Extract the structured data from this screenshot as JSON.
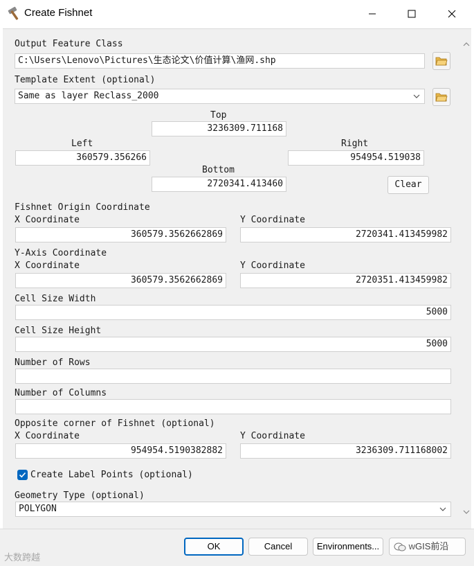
{
  "window": {
    "title": "Create Fishnet",
    "app_icon": "hammer-icon",
    "controls": [
      "minimize-icon",
      "maximize-icon",
      "close-icon"
    ]
  },
  "output_feature_class": {
    "label": "Output Feature Class",
    "value": "C:\\Users\\Lenovo\\Pictures\\生态论文\\价值计算\\渔网.shp"
  },
  "template_extent": {
    "label": "Template Extent (optional)",
    "value": "Same as layer Reclass_2000",
    "top_label": "Top",
    "top": "3236309.711168",
    "left_label": "Left",
    "left": "360579.356266",
    "right_label": "Right",
    "right": "954954.519038",
    "bottom_label": "Bottom",
    "bottom": "2720341.413460",
    "clear_label": "Clear"
  },
  "fishnet_origin": {
    "label": "Fishnet Origin Coordinate",
    "x_label": "X Coordinate",
    "x": "360579.3562662869",
    "y_label": "Y Coordinate",
    "y": "2720341.413459982"
  },
  "y_axis": {
    "label": "Y-Axis Coordinate",
    "x_label": "X Coordinate",
    "x": "360579.3562662869",
    "y_label": "Y Coordinate",
    "y": "2720351.413459982"
  },
  "cell_size_width": {
    "label": "Cell Size Width",
    "value": "5000"
  },
  "cell_size_height": {
    "label": "Cell Size Height",
    "value": "5000"
  },
  "number_of_rows": {
    "label": "Number of Rows",
    "value": ""
  },
  "number_of_columns": {
    "label": "Number of Columns",
    "value": ""
  },
  "opposite_corner": {
    "label": "Opposite corner of Fishnet (optional)",
    "x_label": "X Coordinate",
    "x": "954954.5190382882",
    "y_label": "Y Coordinate",
    "y": "3236309.711168002"
  },
  "create_label_points": {
    "label": "Create Label Points (optional)",
    "checked": true
  },
  "geometry_type": {
    "label": "Geometry Type (optional)",
    "value": "POLYGON"
  },
  "footer": {
    "ok": "OK",
    "cancel": "Cancel",
    "environments": "Environments...",
    "show_help_partial": "w",
    "watermark_left": "大数跨越",
    "watermark_right": "GIS前沿"
  },
  "colors": {
    "accent": "#0067c0",
    "panel": "#f0f0f0",
    "folder": "#e8b84a"
  }
}
